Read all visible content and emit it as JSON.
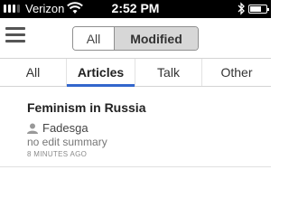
{
  "status": {
    "carrier": "Verizon",
    "time": "2:52 PM"
  },
  "toolbar": {
    "segments": [
      {
        "label": "All",
        "selected": false
      },
      {
        "label": "Modified",
        "selected": true
      }
    ]
  },
  "tabs": [
    {
      "label": "All",
      "active": false
    },
    {
      "label": "Articles",
      "active": true
    },
    {
      "label": "Talk",
      "active": false
    },
    {
      "label": "Other",
      "active": false
    }
  ],
  "items": [
    {
      "title": "Feminism in Russia",
      "user": "Fadesga",
      "summary": "no edit summary",
      "time": "8 MINUTES AGO"
    }
  ],
  "colors": {
    "active_tab_indicator": "#3366cc",
    "selected_segment": "#d7d7d7"
  },
  "icons": [
    "signal-icon",
    "wifi-icon",
    "bluetooth-icon",
    "battery-icon",
    "menu-icon",
    "user-icon"
  ]
}
